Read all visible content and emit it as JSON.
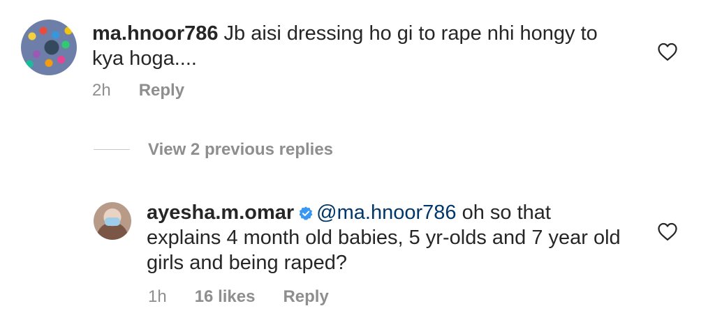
{
  "comments": [
    {
      "username": "ma.hnoor786",
      "text": " Jb aisi dressing ho gi to rape nhi hongy to kya hoga....",
      "time": "2h",
      "reply_label": "Reply"
    },
    {
      "username": "ayesha.m.omar",
      "verified": true,
      "mention": "@ma.hnoor786",
      "text": " oh so that explains 4 month old babies, 5 yr-olds and 7 year old girls and being raped?",
      "time": "1h",
      "likes": "16 likes",
      "reply_label": "Reply"
    }
  ],
  "view_replies": "View 2 previous replies",
  "icons": {
    "like": "heart-icon",
    "verified": "verified-badge-icon"
  },
  "colors": {
    "text": "#262626",
    "muted": "#8e8e8e",
    "mention": "#00376b",
    "verified": "#3897f0"
  }
}
